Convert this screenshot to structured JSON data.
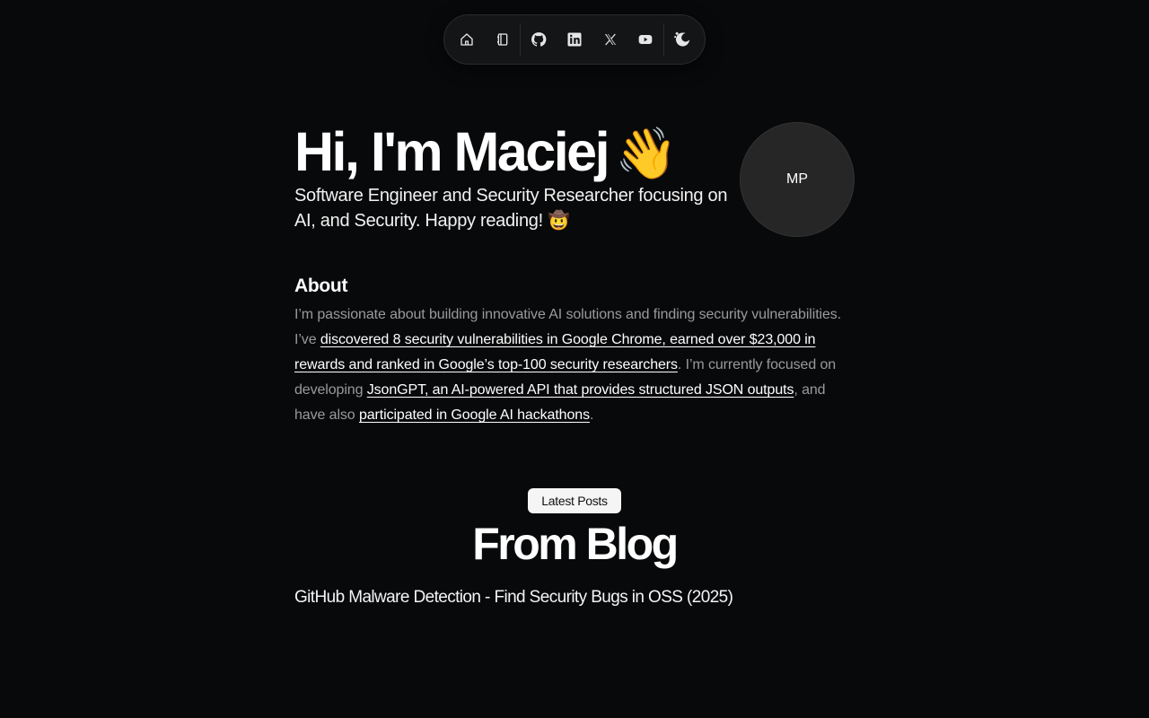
{
  "dock": {
    "items": [
      {
        "icon": "home-icon"
      },
      {
        "icon": "notebook-icon"
      },
      {
        "icon": "github-icon"
      },
      {
        "icon": "linkedin-icon"
      },
      {
        "icon": "x-twitter-icon"
      },
      {
        "icon": "youtube-icon"
      },
      {
        "icon": "theme-toggle-icon"
      }
    ]
  },
  "hero": {
    "title": "Hi, I'm Maciej",
    "wave_emoji": "👋",
    "subtitle": "Software Engineer and Security Researcher focusing on AI, and Security. Happy reading! 🤠",
    "avatar_initials": "MP"
  },
  "about": {
    "heading": "About",
    "text1": "I’m passionate about building innovative AI solutions and finding security vulnerabilities. I’ve ",
    "link1": "discovered 8 security vulnerabilities in Google Chrome, earned over $23,000 in rewards and ranked in Google’s top-100 security researchers",
    "text2": ". I’m currently focused on developing ",
    "link2": "JsonGPT, an AI-powered API that provides structured JSON outputs",
    "text3": ", and have also ",
    "link3": "participated in Google AI hackathons",
    "text4": "."
  },
  "blog": {
    "badge": "Latest Posts",
    "title": "From Blog",
    "posts": [
      {
        "title": "GitHub Malware Detection - Find Security Bugs in OSS (2025)"
      }
    ]
  },
  "colors": {
    "background": "#08090b",
    "text": "#ffffff",
    "muted_text": "#9a9a9a",
    "avatar_bg": "#262626",
    "badge_bg": "#f5f5f5"
  }
}
